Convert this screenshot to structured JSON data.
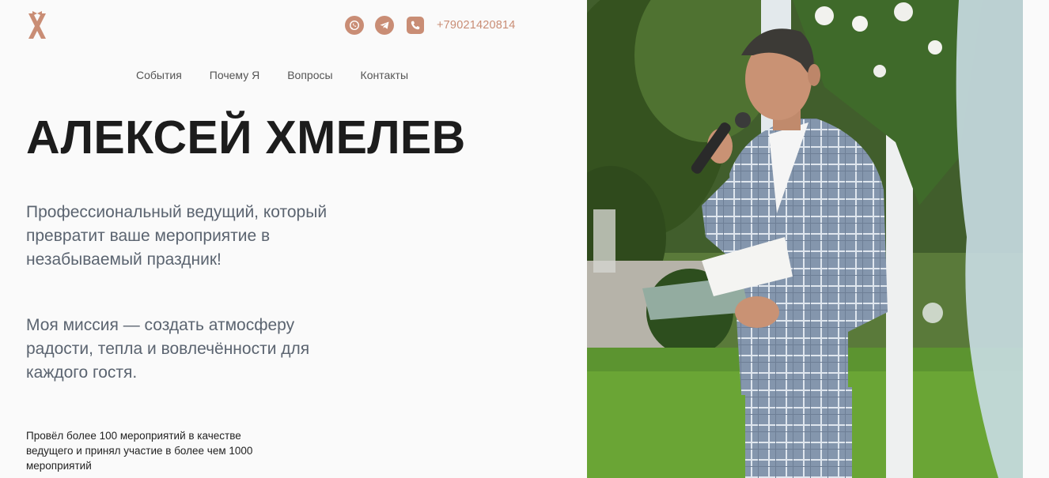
{
  "header": {
    "logo_icon": "x-bow-logo-icon",
    "phone": "+79021420814",
    "icons": [
      "whatsapp-icon",
      "telegram-icon",
      "phone-icon"
    ],
    "accent_color": "#c98d75"
  },
  "nav": {
    "items": [
      {
        "label": "События"
      },
      {
        "label": "Почему Я"
      },
      {
        "label": "Вопросы"
      },
      {
        "label": "Контакты"
      }
    ]
  },
  "hero": {
    "title": "АЛЕКСЕЙ ХМЕЛЕВ",
    "lead": "Профессиональный ведущий, который превратит ваше мероприятие в незабываемый праздник!",
    "mission": "Моя миссия — создать атмосферу радости, тепла и вовлечённости для каждого гостя.",
    "experience": "Провёл более 100 мероприятий в качестве ведущего и принял участие в более чем 1000 мероприятий"
  }
}
